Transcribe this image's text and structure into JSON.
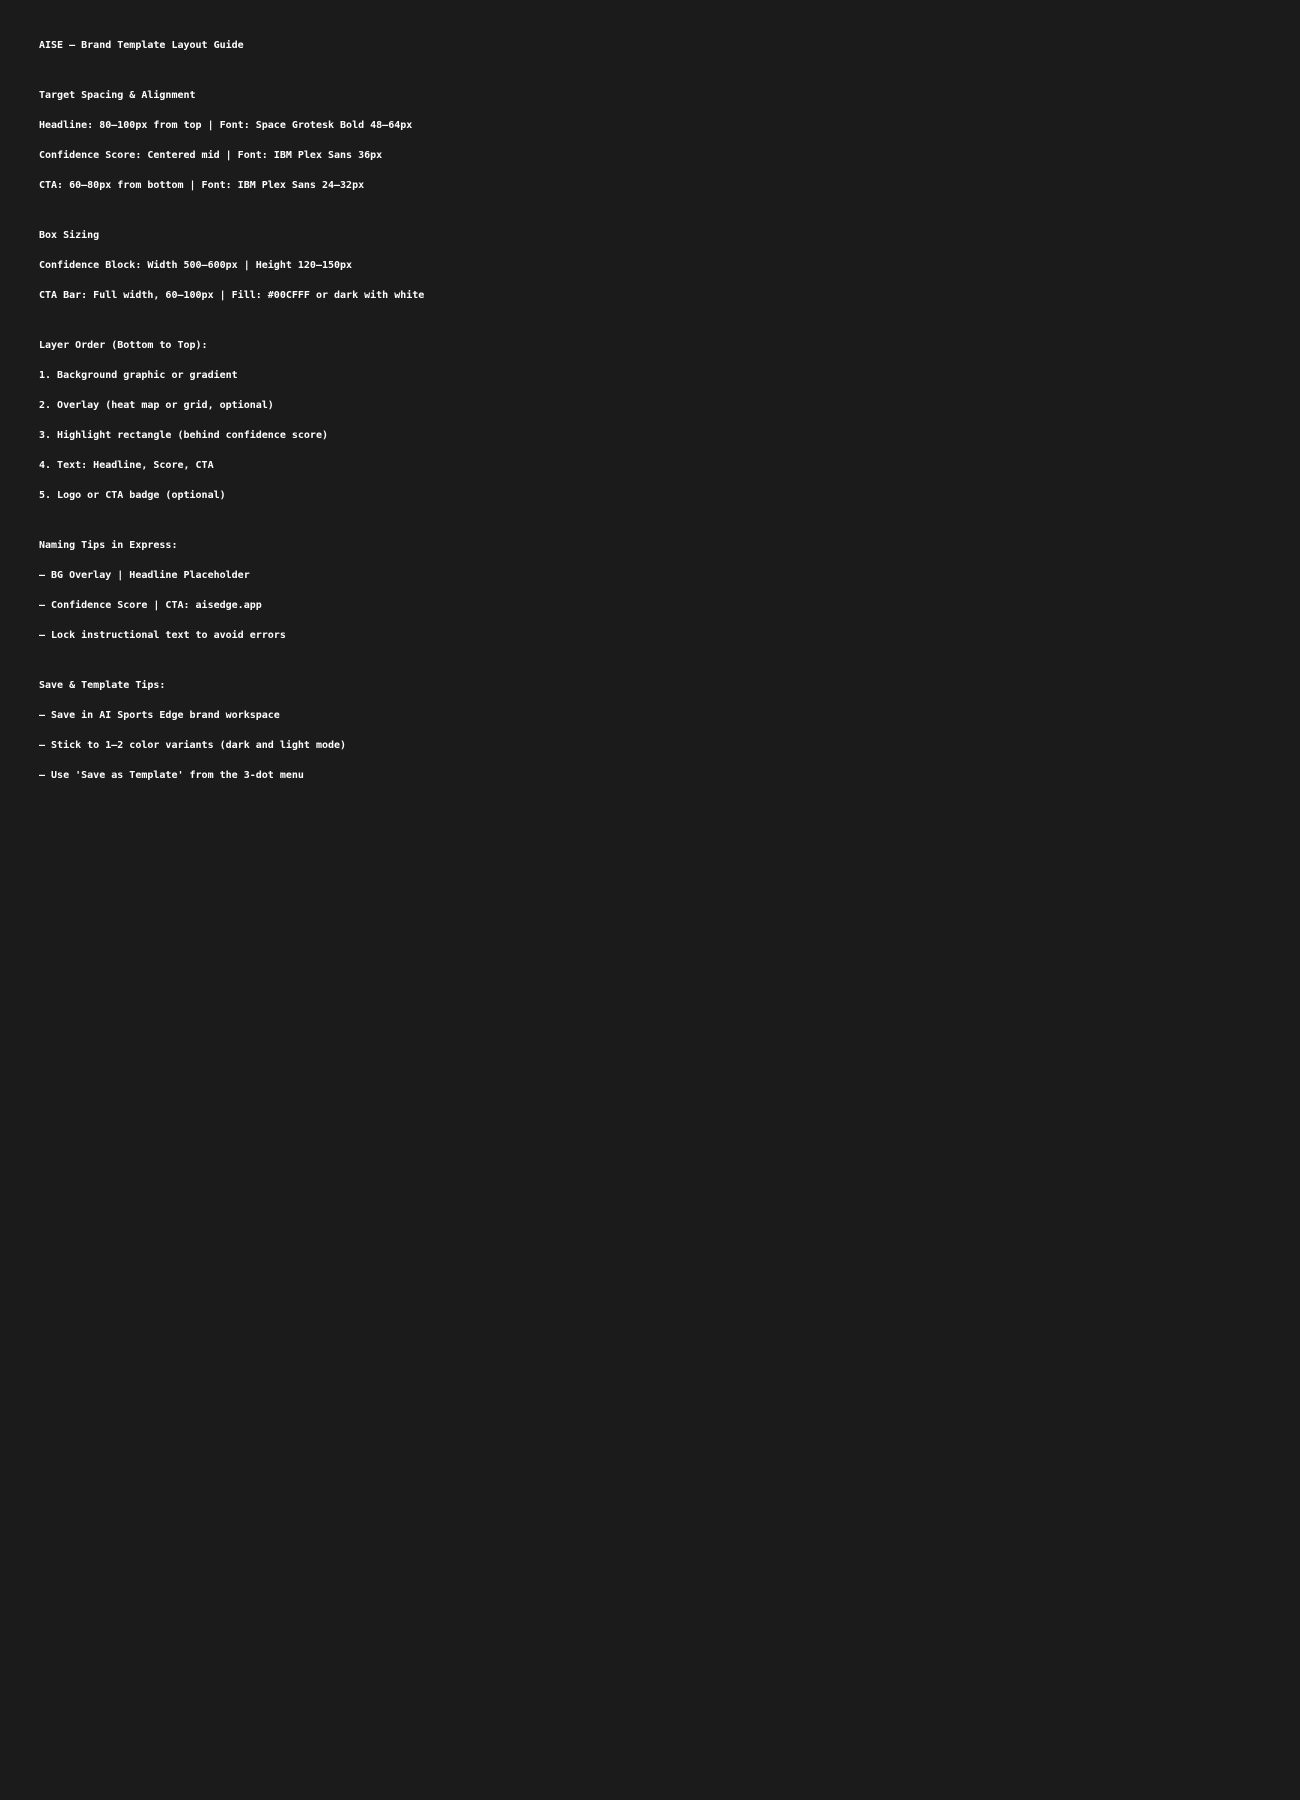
{
  "title": "AISE – Brand Template Layout Guide",
  "sections": [
    {
      "heading": "Target Spacing & Alignment",
      "lines": [
        "Headline: 80–100px from top | Font: Space Grotesk Bold 48–64px",
        "Confidence Score: Centered mid | Font: IBM Plex Sans 36px",
        "CTA: 60–80px from bottom | Font: IBM Plex Sans 24–32px"
      ]
    },
    {
      "heading": "Box Sizing",
      "lines": [
        "Confidence Block: Width 500–600px | Height 120–150px",
        "CTA Bar: Full width, 60–100px | Fill: #00CFFF or dark with white"
      ]
    },
    {
      "heading": "Layer Order (Bottom to Top):",
      "lines": [
        "1. Background graphic or gradient",
        "2. Overlay (heat map or grid, optional)",
        "3. Highlight rectangle (behind confidence score)",
        "4. Text: Headline, Score, CTA",
        "5. Logo or CTA badge (optional)"
      ]
    },
    {
      "heading": "Naming Tips in Express:",
      "lines": [
        "– BG Overlay | Headline Placeholder",
        "– Confidence Score | CTA: aisedge.app",
        "– Lock instructional text to avoid errors"
      ]
    },
    {
      "heading": "Save & Template Tips:",
      "lines": [
        "– Save in AI Sports Edge brand workspace",
        "– Stick to 1–2 color variants (dark and light mode)",
        "– Use 'Save as Template' from the 3-dot menu"
      ]
    }
  ],
  "colors": {
    "background": "#1b1b1b",
    "text": "#ffffff"
  }
}
